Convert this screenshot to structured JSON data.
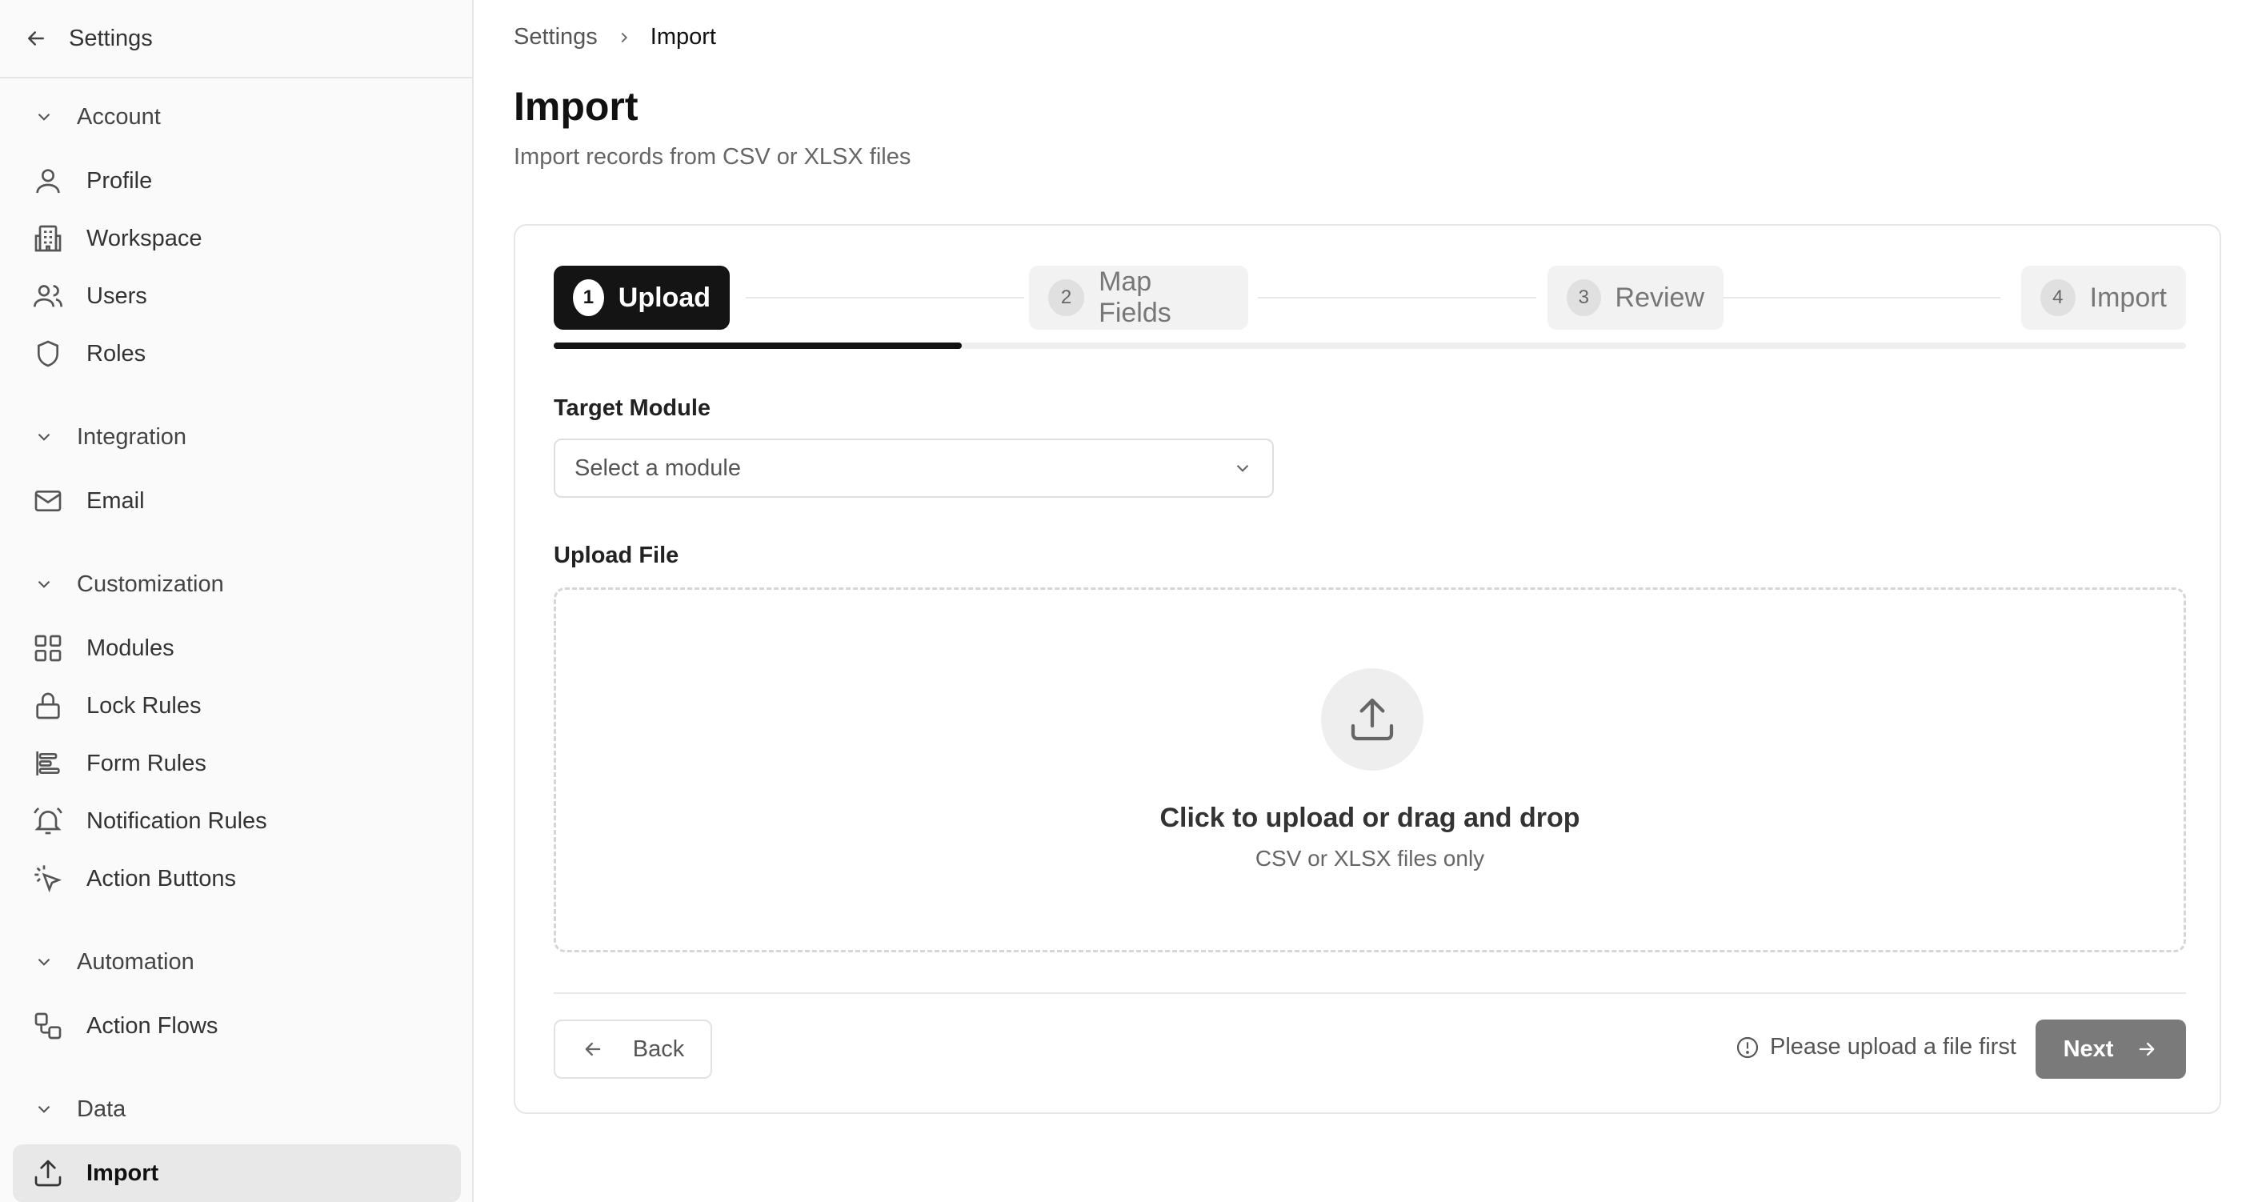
{
  "sidebar": {
    "header": {
      "label": "Settings",
      "icon": "arrow-left-icon"
    },
    "groups": [
      {
        "label": "Account",
        "items": [
          {
            "label": "Profile",
            "icon": "user-icon"
          },
          {
            "label": "Workspace",
            "icon": "building-icon"
          },
          {
            "label": "Users",
            "icon": "users-icon"
          },
          {
            "label": "Roles",
            "icon": "shield-icon"
          }
        ]
      },
      {
        "label": "Integration",
        "items": [
          {
            "label": "Email",
            "icon": "mail-icon"
          }
        ]
      },
      {
        "label": "Customization",
        "items": [
          {
            "label": "Modules",
            "icon": "grid-icon"
          },
          {
            "label": "Lock Rules",
            "icon": "lock-icon"
          },
          {
            "label": "Form Rules",
            "icon": "align-left-icon"
          },
          {
            "label": "Notification Rules",
            "icon": "bell-icon"
          },
          {
            "label": "Action Buttons",
            "icon": "pointer-click-icon"
          }
        ]
      },
      {
        "label": "Automation",
        "items": [
          {
            "label": "Action Flows",
            "icon": "workflow-icon"
          }
        ]
      },
      {
        "label": "Data",
        "items": [
          {
            "label": "Import",
            "icon": "upload-icon",
            "active": true
          }
        ]
      }
    ]
  },
  "breadcrumb": {
    "parent": "Settings",
    "current": "Import"
  },
  "page": {
    "title": "Import",
    "subtitle": "Import records from CSV or XLSX files"
  },
  "stepper": {
    "steps": [
      {
        "number": "1",
        "label": "Upload",
        "active": true
      },
      {
        "number": "2",
        "label": "Map Fields",
        "active": false
      },
      {
        "number": "3",
        "label": "Review",
        "active": false
      },
      {
        "number": "4",
        "label": "Import",
        "active": false
      }
    ],
    "progress_fraction": 0.25
  },
  "form": {
    "target_module_label": "Target Module",
    "target_module_placeholder": "Select a module",
    "upload_label": "Upload File",
    "dropzone_title": "Click to upload or drag and drop",
    "dropzone_subtitle": "CSV or XLSX files only"
  },
  "footer": {
    "back_label": "Back",
    "hint": "Please upload a file first",
    "next_label": "Next"
  },
  "colors": {
    "accent": "#141414",
    "disabled_button": "#7a7a7a",
    "sidebar_bg": "#fafafa",
    "active_item_bg": "#e8e8e8"
  }
}
